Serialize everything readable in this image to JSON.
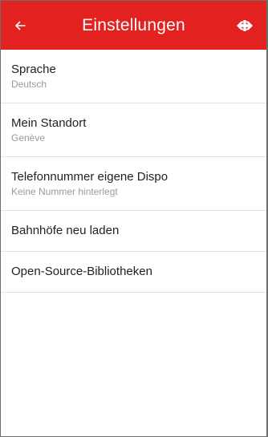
{
  "header": {
    "title": "Einstellungen",
    "back_icon": "arrow-left-icon",
    "logo_icon": "sbb-logo-icon",
    "color": "#e3211f"
  },
  "settings": {
    "items": [
      {
        "title": "Sprache",
        "subtitle": "Deutsch"
      },
      {
        "title": "Mein Standort",
        "subtitle": "Genève"
      },
      {
        "title": "Telefonnummer eigene Dispo",
        "subtitle": "Keine Nummer hinterlegt"
      },
      {
        "title": "Bahnhöfe neu laden"
      },
      {
        "title": "Open-Source-Bibliotheken"
      }
    ]
  }
}
